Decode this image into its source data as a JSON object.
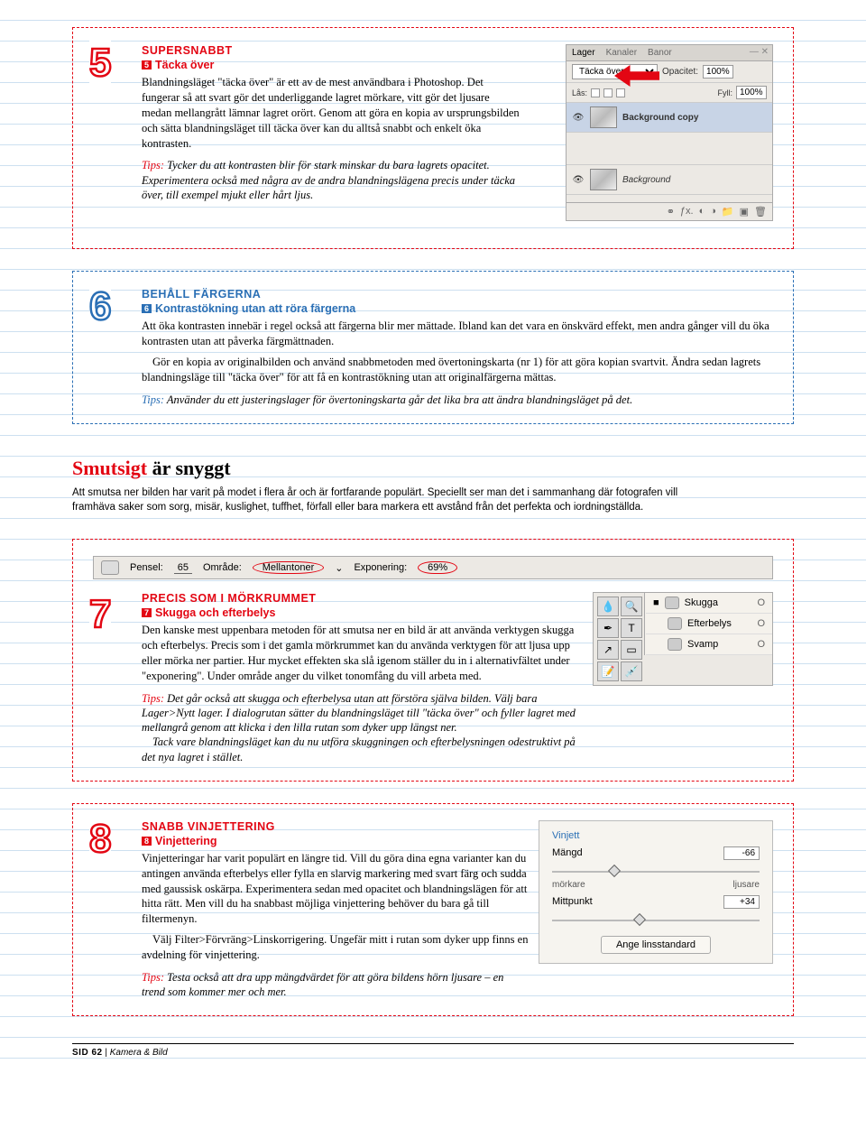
{
  "tip5": {
    "num": "5",
    "heading": "SUPERSNABBT",
    "subnum": "5",
    "sub": "Täcka över",
    "body": "Blandningsläget \"täcka över\" är ett av de mest användbara i Photoshop. Det fungerar så att svart gör det underliggande lagret mörkare, vitt gör det ljusare medan mellangrått lämnar lagret orört. Genom att göra en kopia av ursprungsbilden och sätta blandningsläget till täcka över kan du alltså snabbt och enkelt öka kontrasten.",
    "tipslabel": "Tips:",
    "tips": " Tycker du att kontrasten blir för stark minskar du bara lagrets opacitet. Experimentera också med några av de andra blandningslägena precis under täcka över, till exempel mjukt eller hårt ljus."
  },
  "layers": {
    "tabs": {
      "lager": "Lager",
      "kanaler": "Kanaler",
      "banor": "Banor"
    },
    "blend": "Täcka över",
    "opacitet_label": "Opacitet:",
    "opacitet": "100%",
    "las_label": "Lås:",
    "fyll_label": "Fyll:",
    "fyll": "100%",
    "layer1": "Background copy",
    "layer2": "Background"
  },
  "tip6": {
    "num": "6",
    "heading": "BEHÅLL FÄRGERNA",
    "subnum": "6",
    "sub": "Kontrastökning utan att röra färgerna",
    "body1": "Att öka kontrasten innebär i regel också att färgerna blir mer mättade. Ibland kan det vara en önskvärd effekt, men andra gånger vill du öka kontrasten utan att påverka färgmättnaden.",
    "body2": "Gör en kopia av originalbilden och använd snabbmetoden med övertoningskarta (nr 1) för att göra kopian svartvit. Ändra sedan lagrets blandningsläge till \"täcka över\" för att få en kontrastökning utan att originalfärgerna mättas.",
    "tipslabel": "Tips:",
    "tips": " Använder du ett justeringslager för övertoningskarta går det lika bra att ändra blandningsläget på det."
  },
  "section": {
    "accent": "Smutsigt",
    "rest": " är snyggt",
    "intro": "Att smutsa ner bilden har varit på modet i flera år och är fortfarande populärt. Speciellt ser man det i sammanhang där fotografen vill framhäva saker som sorg, misär, kuslighet, tuffhet, förfall eller bara markera ett avstånd från det perfekta och iordningställda."
  },
  "toolbar7": {
    "pensel_label": "Pensel:",
    "pensel": "65",
    "omrade_label": "Område:",
    "omrade": "Mellantoner",
    "exp_label": "Exponering:",
    "exp": "69%"
  },
  "tip7": {
    "num": "7",
    "heading": "PRECIS SOM I MÖRKRUMMET",
    "subnum": "7",
    "sub": "Skugga och efterbelys",
    "body": "Den kanske mest uppenbara metoden för att smutsa ner en bild är att använda verktygen skugga och efterbelys. Precis som i det gamla mörkrummet kan du använda verktygen för att ljusa upp eller mörka ner partier. Hur mycket effekten ska slå igenom ställer du in i alternativfältet under \"exponering\". Under område anger du vilket tonomfång du vill arbeta med.",
    "tipslabel": "Tips:",
    "tips1": " Det går också att skugga och efterbelysa utan att förstöra själva bilden. Välj bara Lager>Nytt lager. I dialogrutan sätter du blandningsläget till \"täcka över\" och fyller lagret med mellangrå genom att klicka i den lilla rutan som dyker upp längst ner.",
    "tips2": "Tack vare blandningsläget kan du nu utföra skuggningen och efterbelysningen odestruktivt på det nya lagret i stället.",
    "menu": {
      "skugga": "Skugga",
      "efterbelys": "Efterbelys",
      "svamp": "Svamp",
      "key": "O"
    }
  },
  "tip8": {
    "num": "8",
    "heading": "SNABB VINJETTERING",
    "subnum": "8",
    "sub": "Vinjettering",
    "body1": "Vinjetteringar har varit populärt en längre tid. Vill du göra dina egna varianter kan du antingen använda efterbelys eller fylla en slarvig markering med svart färg och sudda med gaussisk oskärpa. Experimentera sedan med opacitet och blandningslägen för att hitta rätt. Men vill du ha snabbast möjliga vinjettering behöver du bara gå till filtermenyn.",
    "body2": "Välj Filter>Förvräng>Linskorrigering. Ungefär mitt i rutan som dyker upp finns en avdelning för vinjettering.",
    "tipslabel": "Tips:",
    "tips": " Testa också att dra upp mängdvärdet för att göra bildens hörn ljusare – en trend som kommer mer och mer.",
    "panel": {
      "title": "Vinjett",
      "mangd_label": "Mängd",
      "mangd": "-66",
      "morkare": "mörkare",
      "ljusare": "ljusare",
      "mitt_label": "Mittpunkt",
      "mitt": "+34",
      "button": "Ange linsstandard"
    }
  },
  "footer": {
    "sid": "SID 62",
    "sep": " | ",
    "mag": "Kamera & Bild"
  }
}
